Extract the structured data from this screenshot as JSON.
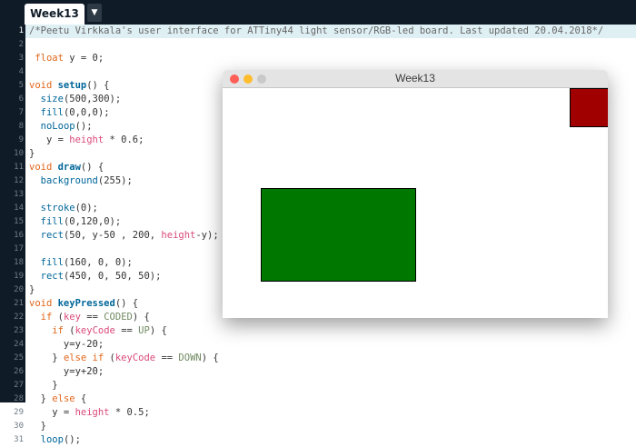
{
  "tabs": [
    {
      "label": "Week13"
    }
  ],
  "tab_menu_glyph": "▼",
  "editor": {
    "active_line": 1,
    "line_numbers": [
      "1",
      "2",
      "3",
      "4",
      "5",
      "6",
      "7",
      "8",
      "9",
      "10",
      "11",
      "12",
      "13",
      "14",
      "15",
      "16",
      "17",
      "18",
      "19",
      "20",
      "21",
      "22",
      "23",
      "24",
      "25",
      "26",
      "27",
      "28",
      "29",
      "30",
      "31"
    ],
    "lines": [
      [
        [
          "c",
          "/*Peetu Virkkala's user interface for ATTiny44 light sensor/RGB-led board. Last updated 20.04.2018*/"
        ]
      ],
      [],
      [
        [
          "k",
          " float"
        ],
        [
          "t",
          " y = 0;"
        ]
      ],
      [],
      [
        [
          "k",
          "void "
        ],
        [
          "f",
          "setup"
        ],
        [
          "t",
          "() {"
        ]
      ],
      [
        [
          "t",
          "  "
        ],
        [
          "a",
          "size"
        ],
        [
          "t",
          "(500,300);"
        ]
      ],
      [
        [
          "t",
          "  "
        ],
        [
          "a",
          "fill"
        ],
        [
          "t",
          "(0,0,0);"
        ]
      ],
      [
        [
          "t",
          "  "
        ],
        [
          "a",
          "noLoop"
        ],
        [
          "t",
          "();"
        ]
      ],
      [
        [
          "t",
          "   y = "
        ],
        [
          "v",
          "height"
        ],
        [
          "t",
          " * 0.6;"
        ]
      ],
      [
        [
          "t",
          "}"
        ]
      ],
      [
        [
          "k",
          "void "
        ],
        [
          "f",
          "draw"
        ],
        [
          "t",
          "() {"
        ]
      ],
      [
        [
          "t",
          "  "
        ],
        [
          "a",
          "background"
        ],
        [
          "t",
          "(255);"
        ]
      ],
      [],
      [
        [
          "t",
          "  "
        ],
        [
          "a",
          "stroke"
        ],
        [
          "t",
          "(0);"
        ]
      ],
      [
        [
          "t",
          "  "
        ],
        [
          "a",
          "fill"
        ],
        [
          "t",
          "(0,120,0);"
        ]
      ],
      [
        [
          "t",
          "  "
        ],
        [
          "a",
          "rect"
        ],
        [
          "t",
          "(50, y-50 , 200, "
        ],
        [
          "v",
          "height"
        ],
        [
          "t",
          "-y);"
        ]
      ],
      [],
      [
        [
          "t",
          "  "
        ],
        [
          "a",
          "fill"
        ],
        [
          "t",
          "(160, 0, 0);"
        ]
      ],
      [
        [
          "t",
          "  "
        ],
        [
          "a",
          "rect"
        ],
        [
          "t",
          "(450, 0, 50, 50);"
        ]
      ],
      [
        [
          "t",
          "}"
        ]
      ],
      [
        [
          "k",
          "void "
        ],
        [
          "f",
          "keyPressed"
        ],
        [
          "t",
          "() {"
        ]
      ],
      [
        [
          "t",
          "  "
        ],
        [
          "k",
          "if"
        ],
        [
          "t",
          " ("
        ],
        [
          "v",
          "key"
        ],
        [
          "t",
          " == "
        ],
        [
          "n",
          "CODED"
        ],
        [
          "t",
          ") {"
        ]
      ],
      [
        [
          "t",
          "    "
        ],
        [
          "k",
          "if"
        ],
        [
          "t",
          " ("
        ],
        [
          "v",
          "keyCode"
        ],
        [
          "t",
          " == "
        ],
        [
          "n",
          "UP"
        ],
        [
          "t",
          ") {"
        ]
      ],
      [
        [
          "t",
          "      y=y-20;"
        ]
      ],
      [
        [
          "t",
          "    } "
        ],
        [
          "k",
          "else if"
        ],
        [
          "t",
          " ("
        ],
        [
          "v",
          "keyCode"
        ],
        [
          "t",
          " == "
        ],
        [
          "n",
          "DOWN"
        ],
        [
          "t",
          ") {"
        ]
      ],
      [
        [
          "t",
          "      y=y+20;"
        ]
      ],
      [
        [
          "t",
          "    }"
        ]
      ],
      [
        [
          "t",
          "  } "
        ],
        [
          "k",
          "else"
        ],
        [
          "t",
          " {"
        ]
      ],
      [
        [
          "t",
          "    y = "
        ],
        [
          "v",
          "height"
        ],
        [
          "t",
          " * 0.5;"
        ]
      ],
      [
        [
          "t",
          "  }"
        ]
      ],
      [
        [
          "t",
          "  "
        ],
        [
          "a",
          "loop"
        ],
        [
          "t",
          "();"
        ]
      ]
    ]
  },
  "sketch_window": {
    "title": "Week13",
    "canvas_color": "#ffffff",
    "rects": [
      {
        "name": "green-rect",
        "fill": "#007800"
      },
      {
        "name": "red-rect",
        "fill": "#a00000"
      }
    ]
  },
  "colors": {
    "keyword": "#e2661a",
    "function": "#006699",
    "variable": "#d94a7a",
    "constant": "#718a62",
    "comment": "#666666",
    "gutter_bg": "#0f1b27"
  }
}
